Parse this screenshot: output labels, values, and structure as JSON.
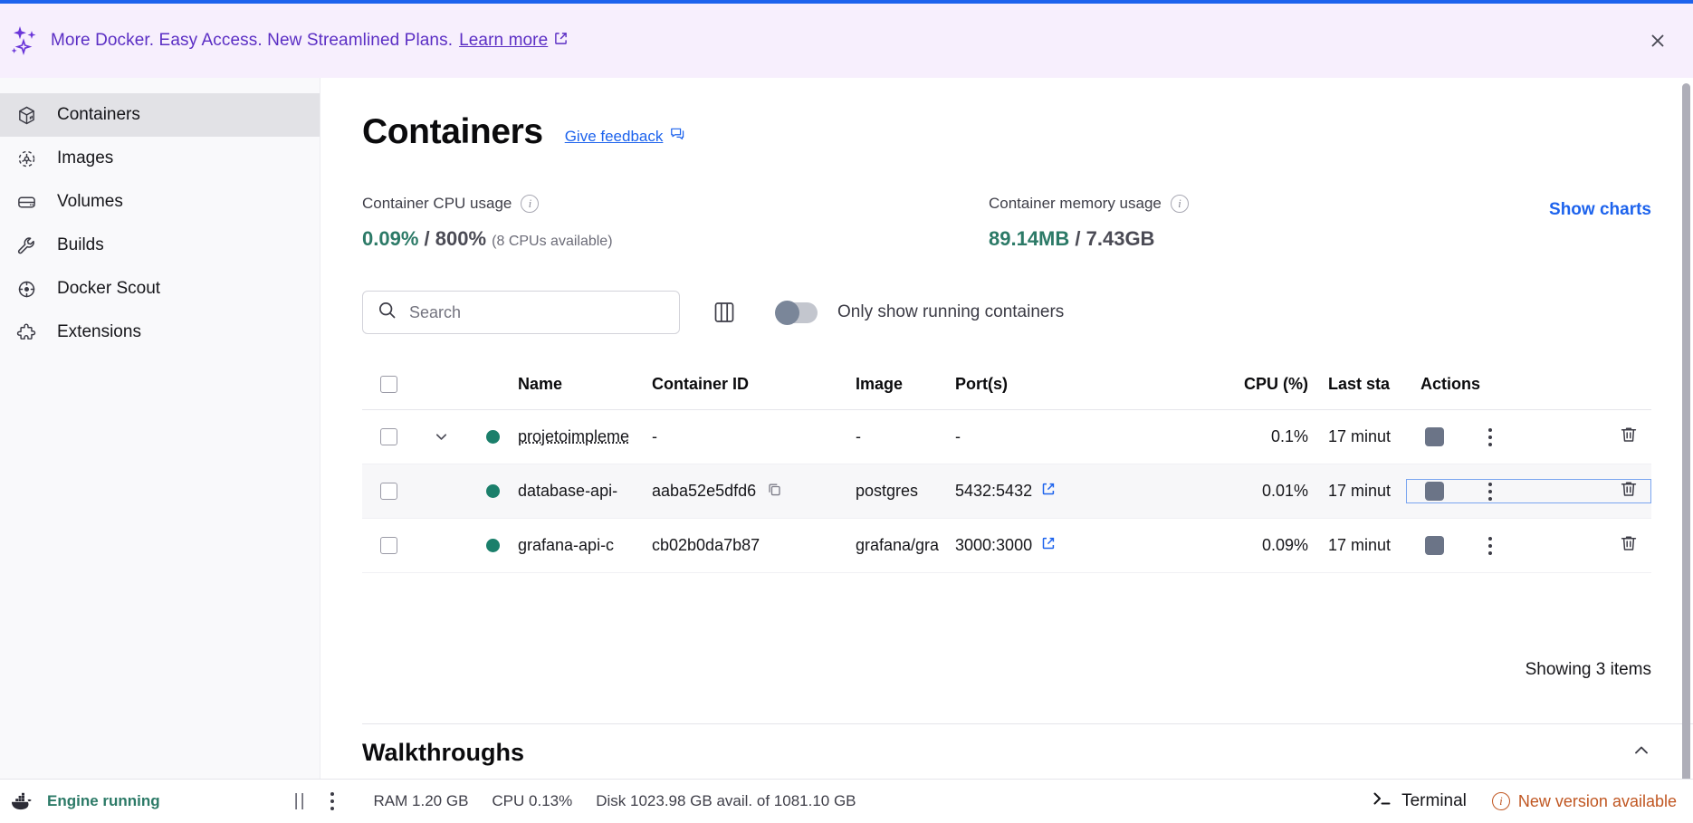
{
  "banner": {
    "message": "More Docker. Easy Access. New Streamlined Plans.",
    "link_label": "Learn more",
    "sparkle_icon": "sparkle-icon",
    "external_icon": "external-link-icon",
    "close_icon": "close-icon",
    "bg": "#f7effd",
    "text_color": "#5b2ec4"
  },
  "sidebar": {
    "items": [
      {
        "label": "Containers",
        "icon": "container-cube-icon",
        "active": true
      },
      {
        "label": "Images",
        "icon": "images-icon",
        "active": false
      },
      {
        "label": "Volumes",
        "icon": "volumes-icon",
        "active": false
      },
      {
        "label": "Builds",
        "icon": "wrench-icon",
        "active": false
      },
      {
        "label": "Docker Scout",
        "icon": "scout-icon",
        "active": false
      },
      {
        "label": "Extensions",
        "icon": "extensions-icon",
        "active": false
      }
    ]
  },
  "page": {
    "title": "Containers",
    "feedback_label": "Give feedback",
    "feedback_icon": "feedback-icon"
  },
  "stats": {
    "cpu": {
      "label": "Container CPU usage",
      "used": "0.09%",
      "separator": " / ",
      "total": "800%",
      "note": "(8 CPUs available)"
    },
    "memory": {
      "label": "Container memory usage",
      "used": "89.14MB",
      "separator": " / ",
      "total": "7.43GB"
    },
    "show_charts_label": "Show charts",
    "accent": "#1d63ed",
    "value_color": "#2c7a67"
  },
  "filters": {
    "search_placeholder": "Search",
    "search_value": "",
    "search_icon": "search-icon",
    "columns_icon": "columns-icon",
    "toggle_label": "Only show running containers",
    "toggle_on": false
  },
  "table": {
    "columns": [
      "",
      "",
      "",
      "Name",
      "Container ID",
      "Image",
      "Port(s)",
      "CPU (%)",
      "Last sta",
      "Actions"
    ],
    "headers": {
      "name": "Name",
      "container_id": "Container ID",
      "image": "Image",
      "ports": "Port(s)",
      "cpu": "CPU (%)",
      "last_started": "Last sta",
      "actions": "Actions"
    },
    "rows": [
      {
        "name": "projetoimpleme",
        "container_id": "-",
        "image": "-",
        "ports": "-",
        "cpu": "0.1%",
        "last_started": "17 minut",
        "status": "running",
        "expandable": true,
        "focused": false,
        "has_copy": false,
        "has_port_link": false
      },
      {
        "name": "database-api-",
        "container_id": "aaba52e5dfd6",
        "image": "postgres",
        "ports": "5432:5432",
        "cpu": "0.01%",
        "last_started": "17 minut",
        "status": "running",
        "expandable": false,
        "focused": true,
        "has_copy": true,
        "has_port_link": true
      },
      {
        "name": "grafana-api-c",
        "container_id": "cb02b0da7b87",
        "image": "grafana/gra",
        "ports": "3000:3000",
        "cpu": "0.09%",
        "last_started": "17 minut",
        "status": "running",
        "expandable": false,
        "focused": false,
        "has_copy": false,
        "has_port_link": true
      }
    ],
    "actions": {
      "stop_icon": "stop-icon",
      "more_icon": "kebab-menu-icon",
      "delete_icon": "trash-icon"
    },
    "showing_label": "Showing 3 items"
  },
  "walkthroughs": {
    "title": "Walkthroughs",
    "collapse_icon": "chevron-up-icon"
  },
  "statusbar": {
    "engine_status": "Engine running",
    "whale_icon": "docker-whale-icon",
    "pause_icon": "pause-icon",
    "kebab_icon": "kebab-menu-icon",
    "ram": "RAM 1.20 GB",
    "cpu": "CPU 0.13%",
    "disk": "Disk 1023.98 GB avail. of 1081.10 GB",
    "terminal_label": "Terminal",
    "terminal_icon": "terminal-prompt-icon",
    "new_version_label": "New version available",
    "new_version_icon": "info-circle-icon",
    "new_version_color": "#c05621",
    "engine_color": "#2c7a67"
  }
}
